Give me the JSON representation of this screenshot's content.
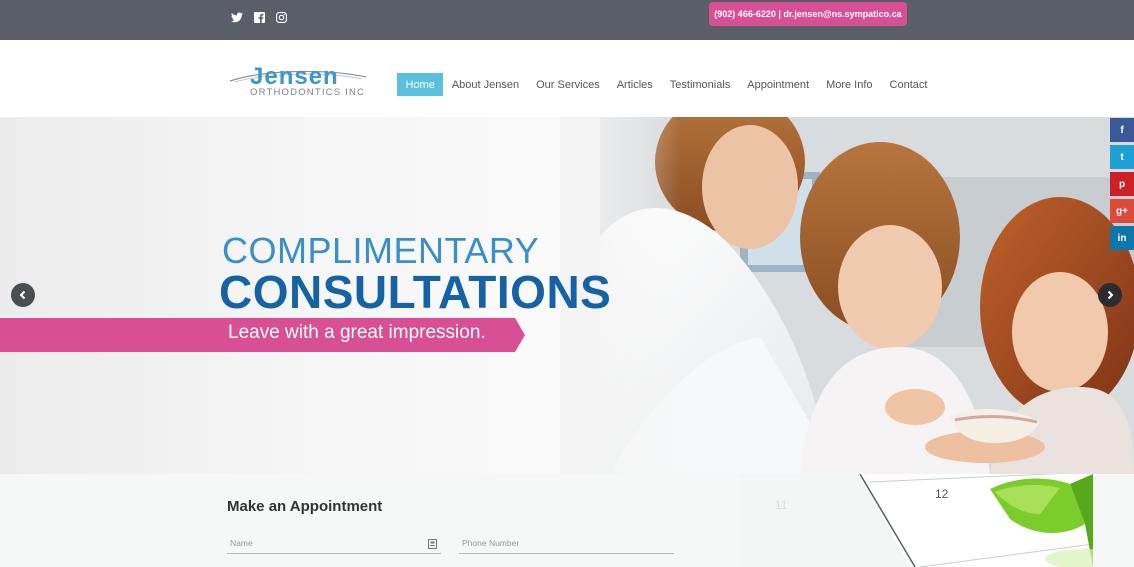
{
  "topbar": {
    "social_icons": [
      "twitter-icon",
      "facebook-icon",
      "instagram-icon"
    ],
    "contact": "(902) 466-6220 | dr.jensen@ns.sympatico.ca",
    "bg_color": "#5a5e66",
    "accent_color": "#d94f96"
  },
  "header": {
    "logo_main": "Jensen",
    "logo_sub": "ORTHODONTICS INC",
    "nav": [
      {
        "label": "Home",
        "active": true
      },
      {
        "label": "About Jensen",
        "active": false
      },
      {
        "label": "Our Services",
        "active": false
      },
      {
        "label": "Articles",
        "active": false
      },
      {
        "label": "Testimonials",
        "active": false
      },
      {
        "label": "Appointment",
        "active": false
      },
      {
        "label": "More Info",
        "active": false
      },
      {
        "label": "Contact",
        "active": false
      }
    ],
    "active_color": "#5bc0de"
  },
  "hero": {
    "title_line1": "COMPLIMENTARY",
    "title_line2": "CONSULTATIONS",
    "tagline": "Leave with a great impression.",
    "prev_icon": "chevron-left-icon",
    "next_icon": "chevron-right-icon"
  },
  "share_bar": [
    {
      "icon": "facebook-icon",
      "glyph": "f",
      "color": "#3b5998"
    },
    {
      "icon": "twitter-icon",
      "glyph": "t",
      "color": "#1da1d4"
    },
    {
      "icon": "pinterest-icon",
      "glyph": "p",
      "color": "#cb2027"
    },
    {
      "icon": "google-plus-icon",
      "glyph": "g+",
      "color": "#dc4a38"
    },
    {
      "icon": "linkedin-icon",
      "glyph": "in",
      "color": "#0e76a8"
    }
  ],
  "appointment": {
    "title": "Make an Appointment",
    "name_placeholder": "Name",
    "phone_placeholder": "Phone Number"
  }
}
